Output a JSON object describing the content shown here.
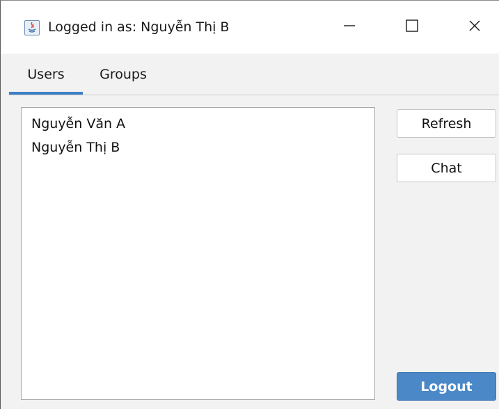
{
  "window": {
    "title": "Logged in as: Nguyễn Thị B",
    "app_icon": "java-icon",
    "controls": {
      "minimize": "minimize-icon",
      "maximize": "maximize-icon",
      "close": "close-icon"
    }
  },
  "tabs": [
    {
      "label": "Users",
      "selected": true
    },
    {
      "label": "Groups",
      "selected": false
    }
  ],
  "users": {
    "items": [
      "Nguyễn Văn A",
      "Nguyễn Thị B"
    ]
  },
  "actions": {
    "refresh_label": "Refresh",
    "chat_label": "Chat",
    "logout_label": "Logout"
  },
  "colors": {
    "accent": "#3c7fc4",
    "logout_bg": "#4a88c8"
  }
}
